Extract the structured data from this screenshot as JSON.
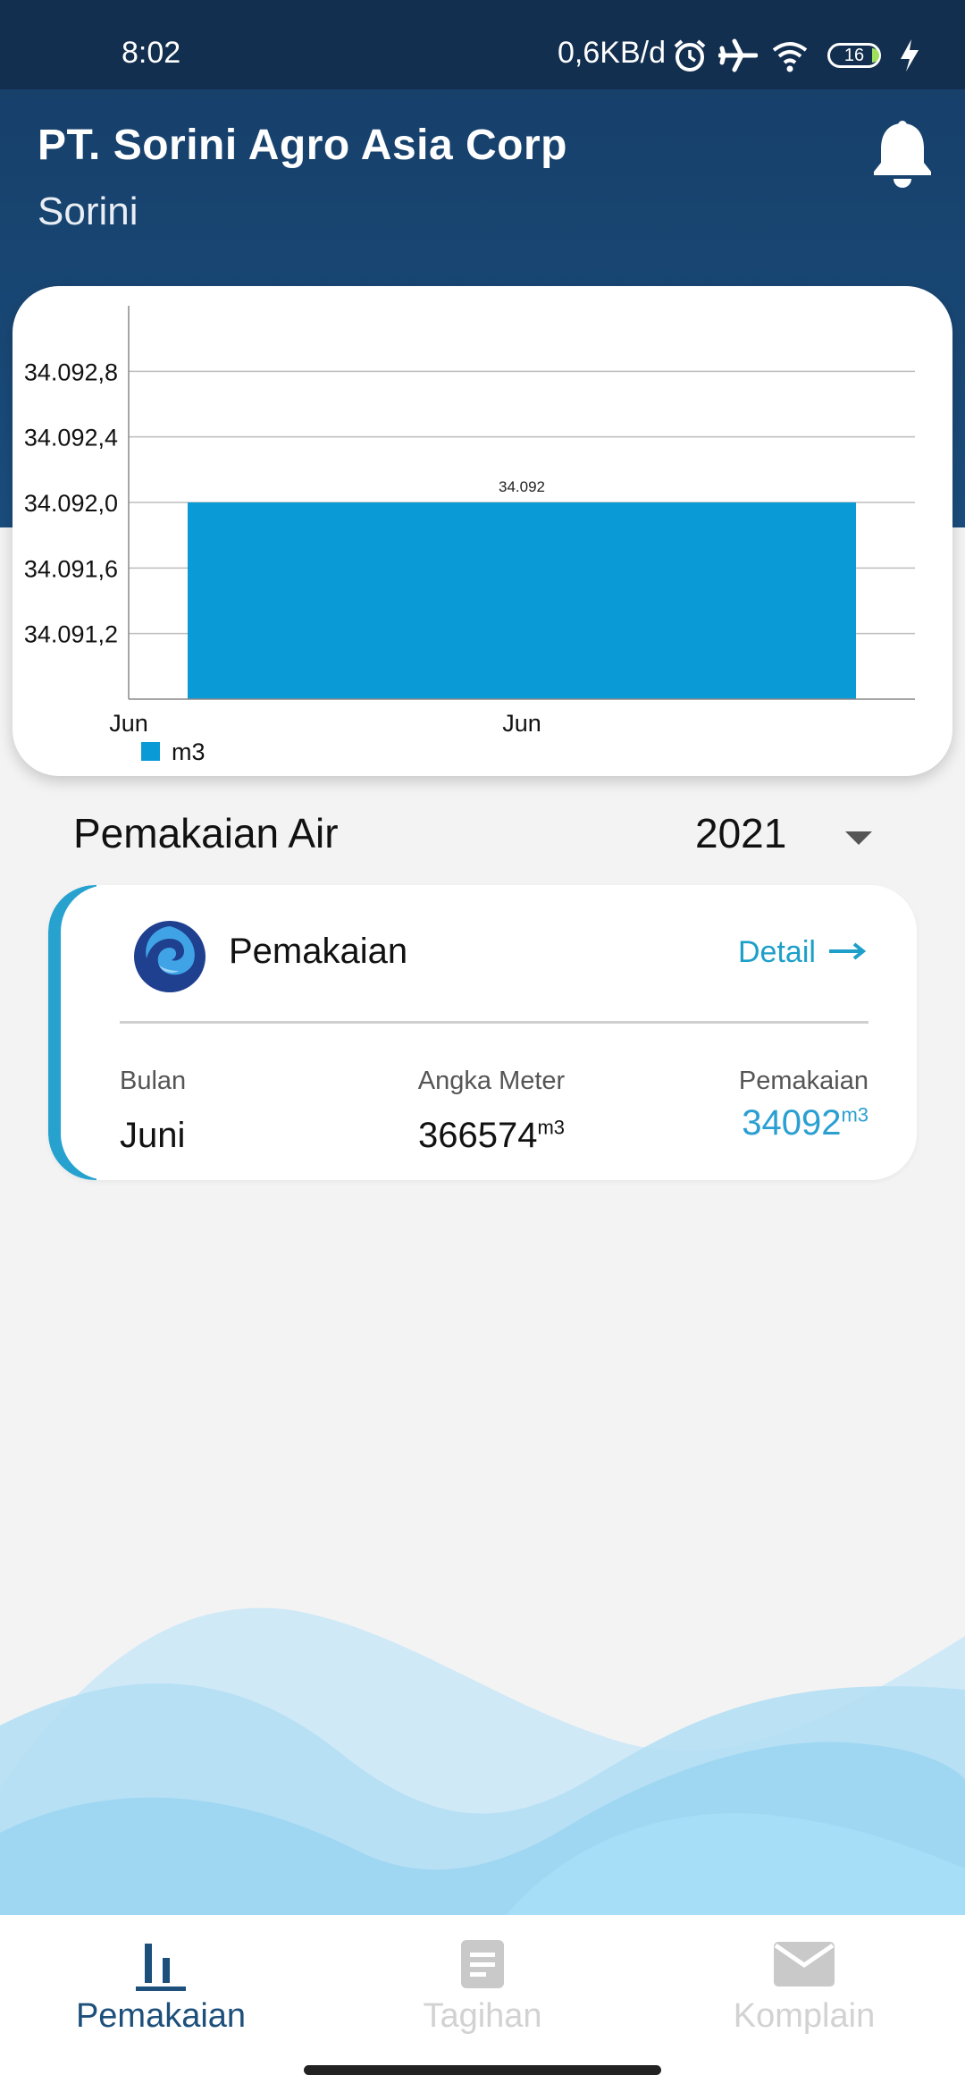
{
  "status_bar": {
    "time": "8:02",
    "network_speed": "0,6KB/d",
    "battery": "16",
    "icons": [
      "alarm-icon",
      "airplane-icon",
      "wifi-icon",
      "battery-icon",
      "charging-icon"
    ]
  },
  "header": {
    "company": "PT. Sorini Agro Asia Corp",
    "site": "Sorini",
    "bell_icon": "bell-icon"
  },
  "chart_data": {
    "type": "bar",
    "x_ticks": [
      "Jun",
      "Jun"
    ],
    "categories": [
      "Jun"
    ],
    "series": [
      {
        "name": "m3",
        "values": [
          34.092
        ],
        "color": "#0a9bd6",
        "data_labels": [
          "34.092"
        ]
      }
    ],
    "y_tick_labels": [
      "34.091,2",
      "34.091,6",
      "34.092,0",
      "34.092,4",
      "34.092,8"
    ],
    "y_ticks": [
      34.0912,
      34.0916,
      34.092,
      34.0924,
      34.0928
    ],
    "ylim": [
      34.0908,
      34.0932
    ],
    "grid": true,
    "legend_position": "bottom-left"
  },
  "section": {
    "title": "Pemakaian Air",
    "year": "2021"
  },
  "usage_card": {
    "title": "Pemakaian",
    "detail_label": "Detail",
    "col_month_label": "Bulan",
    "col_meter_label": "Angka Meter",
    "col_usage_label": "Pemakaian",
    "month": "Juni",
    "meter_value": "366574",
    "usage_value": "34092",
    "unit": "m3",
    "accent_color": "#27a2cf"
  },
  "bottom_nav": {
    "items": [
      {
        "label": "Pemakaian",
        "icon": "bar-chart-icon",
        "active": true
      },
      {
        "label": "Tagihan",
        "icon": "document-icon",
        "active": false
      },
      {
        "label": "Komplain",
        "icon": "mail-icon",
        "active": false
      }
    ]
  }
}
